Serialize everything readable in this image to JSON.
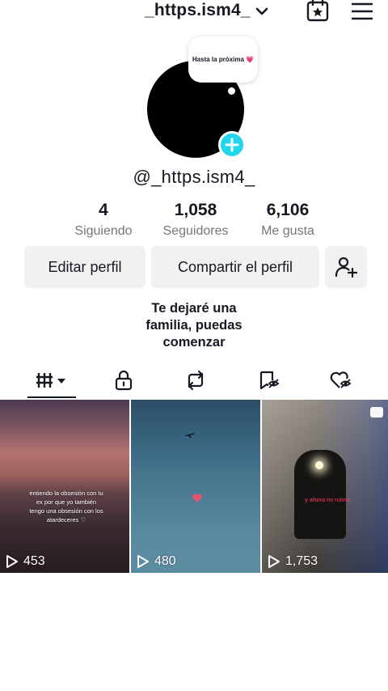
{
  "header": {
    "username": "_https.ism4_",
    "icons": [
      "chevron-down-icon",
      "calendar-star-icon",
      "hamburger-menu-icon"
    ]
  },
  "note": {
    "text": "Hasta la próxima 💗"
  },
  "profile": {
    "handle": "@_https.ism4_",
    "bio_lines": [
      "Te dejaré una",
      "familia, puedas",
      "comenzar"
    ]
  },
  "stats": [
    {
      "value": "4",
      "label": "Siguiendo"
    },
    {
      "value": "1,058",
      "label": "Seguidores"
    },
    {
      "value": "6,106",
      "label": "Me gusta"
    }
  ],
  "buttons": {
    "edit": "Editar perfil",
    "share": "Compartir el perfil"
  },
  "tabs": [
    "videos-grid-icon",
    "lock-icon",
    "repost-icon",
    "favorites-icon",
    "liked-icon"
  ],
  "videos": [
    {
      "views": "453",
      "caption": [
        "entiendo la obsesión con tu",
        "ex por que yo también",
        "tengo una obsesión con los",
        "atardeceres ♡"
      ]
    },
    {
      "views": "480"
    },
    {
      "views": "1,753",
      "caption": [
        "y ahora mi rutina"
      ]
    }
  ],
  "colors": {
    "accent": "#20d5ec",
    "text": "#161823",
    "muted": "#75767c",
    "button_bg": "#f1f1f2"
  }
}
